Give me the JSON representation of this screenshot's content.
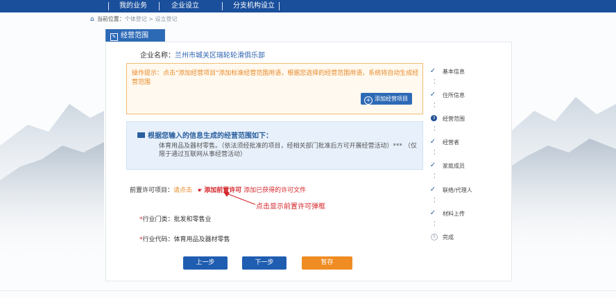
{
  "topnav": {
    "items": [
      "我的业务",
      "企业设立",
      "分支机构设立"
    ]
  },
  "breadcrumb": {
    "prefix": "当前位置：",
    "path": "个体登记 > 设立登记"
  },
  "tab": {
    "label": "经营范围"
  },
  "company": {
    "label": "企业名称：",
    "value": "兰州市城关区瑞轮轮滑俱乐部"
  },
  "tip": {
    "text": "操作提示：点击\"添加经营项目\"添加标准经营范围用语，根据您选择的经营范围用语，系统将自动生成经营范围",
    "add_button": "添加经营项目"
  },
  "result": {
    "title": "根据您输入的信息生成的经营范围如下：",
    "description": "体育用品及器材零售。（依法须经批准的项目，经相关部门批准后方可开展经营活动）*** （仅限于通过互联网从事经营活动）"
  },
  "permit": {
    "label": "前置许可项目：",
    "click_hint": "请点击",
    "link": "添加前置许可",
    "note": "添加已获得的许可文件"
  },
  "callout": "点击显示前置许可弹框",
  "fields": {
    "industry_category": "行业门类：批发和零售业",
    "industry_code": "行业代码：体育用品及器材零售"
  },
  "buttons": {
    "prev": "上一步",
    "next": "下一步",
    "save": "暂存"
  },
  "steps": [
    {
      "label": "基本信息",
      "status": "done"
    },
    {
      "label": "住所信息",
      "status": "done"
    },
    {
      "label": "经营范围",
      "status": "current",
      "number": "3"
    },
    {
      "label": "经营者",
      "status": "done"
    },
    {
      "label": "家庭成员",
      "status": "done"
    },
    {
      "label": "联络/代理人",
      "status": "done"
    },
    {
      "label": "材料上传",
      "status": "done"
    },
    {
      "label": "完成",
      "status": "pending",
      "number": "8"
    }
  ],
  "colors": {
    "nav_blue": "#1a4f9c",
    "primary_button": "#1f5db1",
    "save_button": "#ef8c23",
    "warning_text": "#e88a2a",
    "alert_red": "#d4252a"
  }
}
